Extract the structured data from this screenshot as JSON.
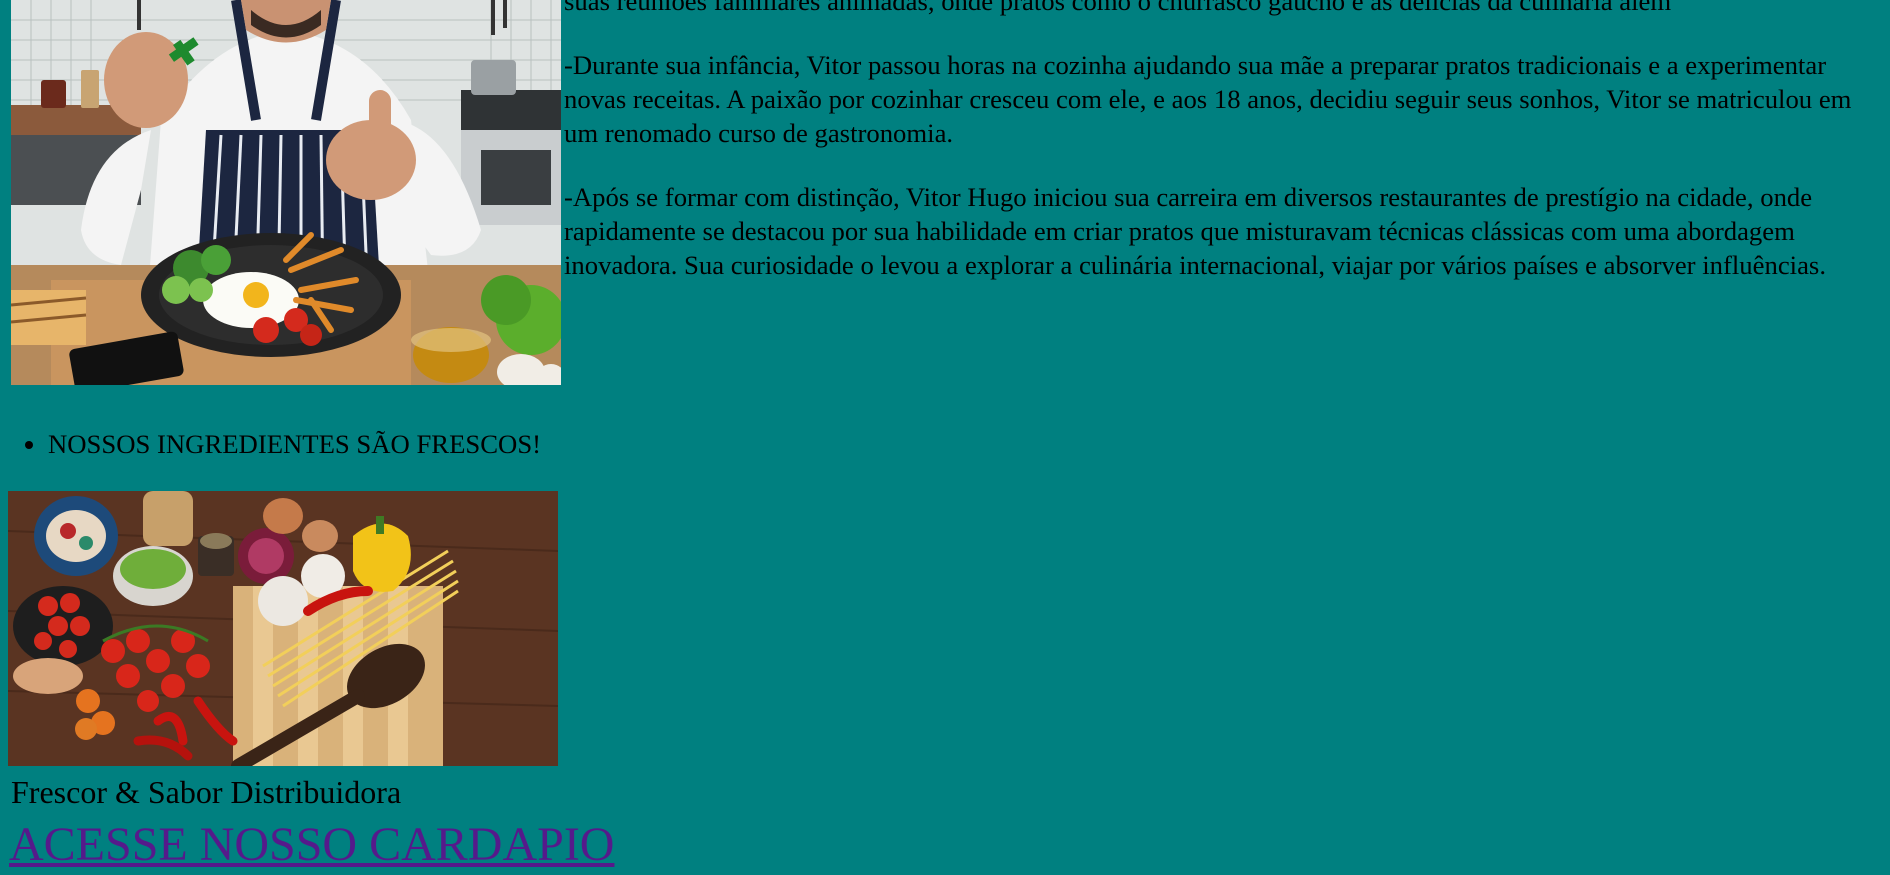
{
  "bio": {
    "paragraphs": [
      "suas reuniões familiares animadas, onde pratos como o churrasco gaúcho e as delícias da culinária alem",
      "-Durante sua infância, Vitor passou horas na cozinha ajudando sua mãe a preparar pratos tradicionais e a experimentar novas receitas. A paixão por cozinhar cresceu com ele, e aos 18 anos, decidiu seguir seus sonhos, Vitor se matriculou em um renomado curso de gastronomia.",
      "-Após se formar com distinção, Vitor Hugo iniciou sua carreira em diversos restaurantes de prestígio na cidade, onde rapidamente se destacou por sua habilidade em criar pratos que misturavam técnicas clássicas com uma abordagem inovadora. Sua curiosidade o levou a explorar a culinária internacional, viajar por vários países e absorver influências."
    ]
  },
  "highlights": {
    "items": [
      "NOSSOS INGREDIENTES SÃO FRESCOS!"
    ]
  },
  "ingredients": {
    "caption": "Frescor & Sabor Distribuidora"
  },
  "menu_link": {
    "label": "ACESSE NOSSO CARDAPIO"
  },
  "colors": {
    "page_background": "#008080",
    "link_visited": "#551a8b"
  },
  "icons": {
    "chef_photo": "chef-thumbs-up-photo",
    "ingredients_photo": "fresh-ingredients-photo"
  }
}
